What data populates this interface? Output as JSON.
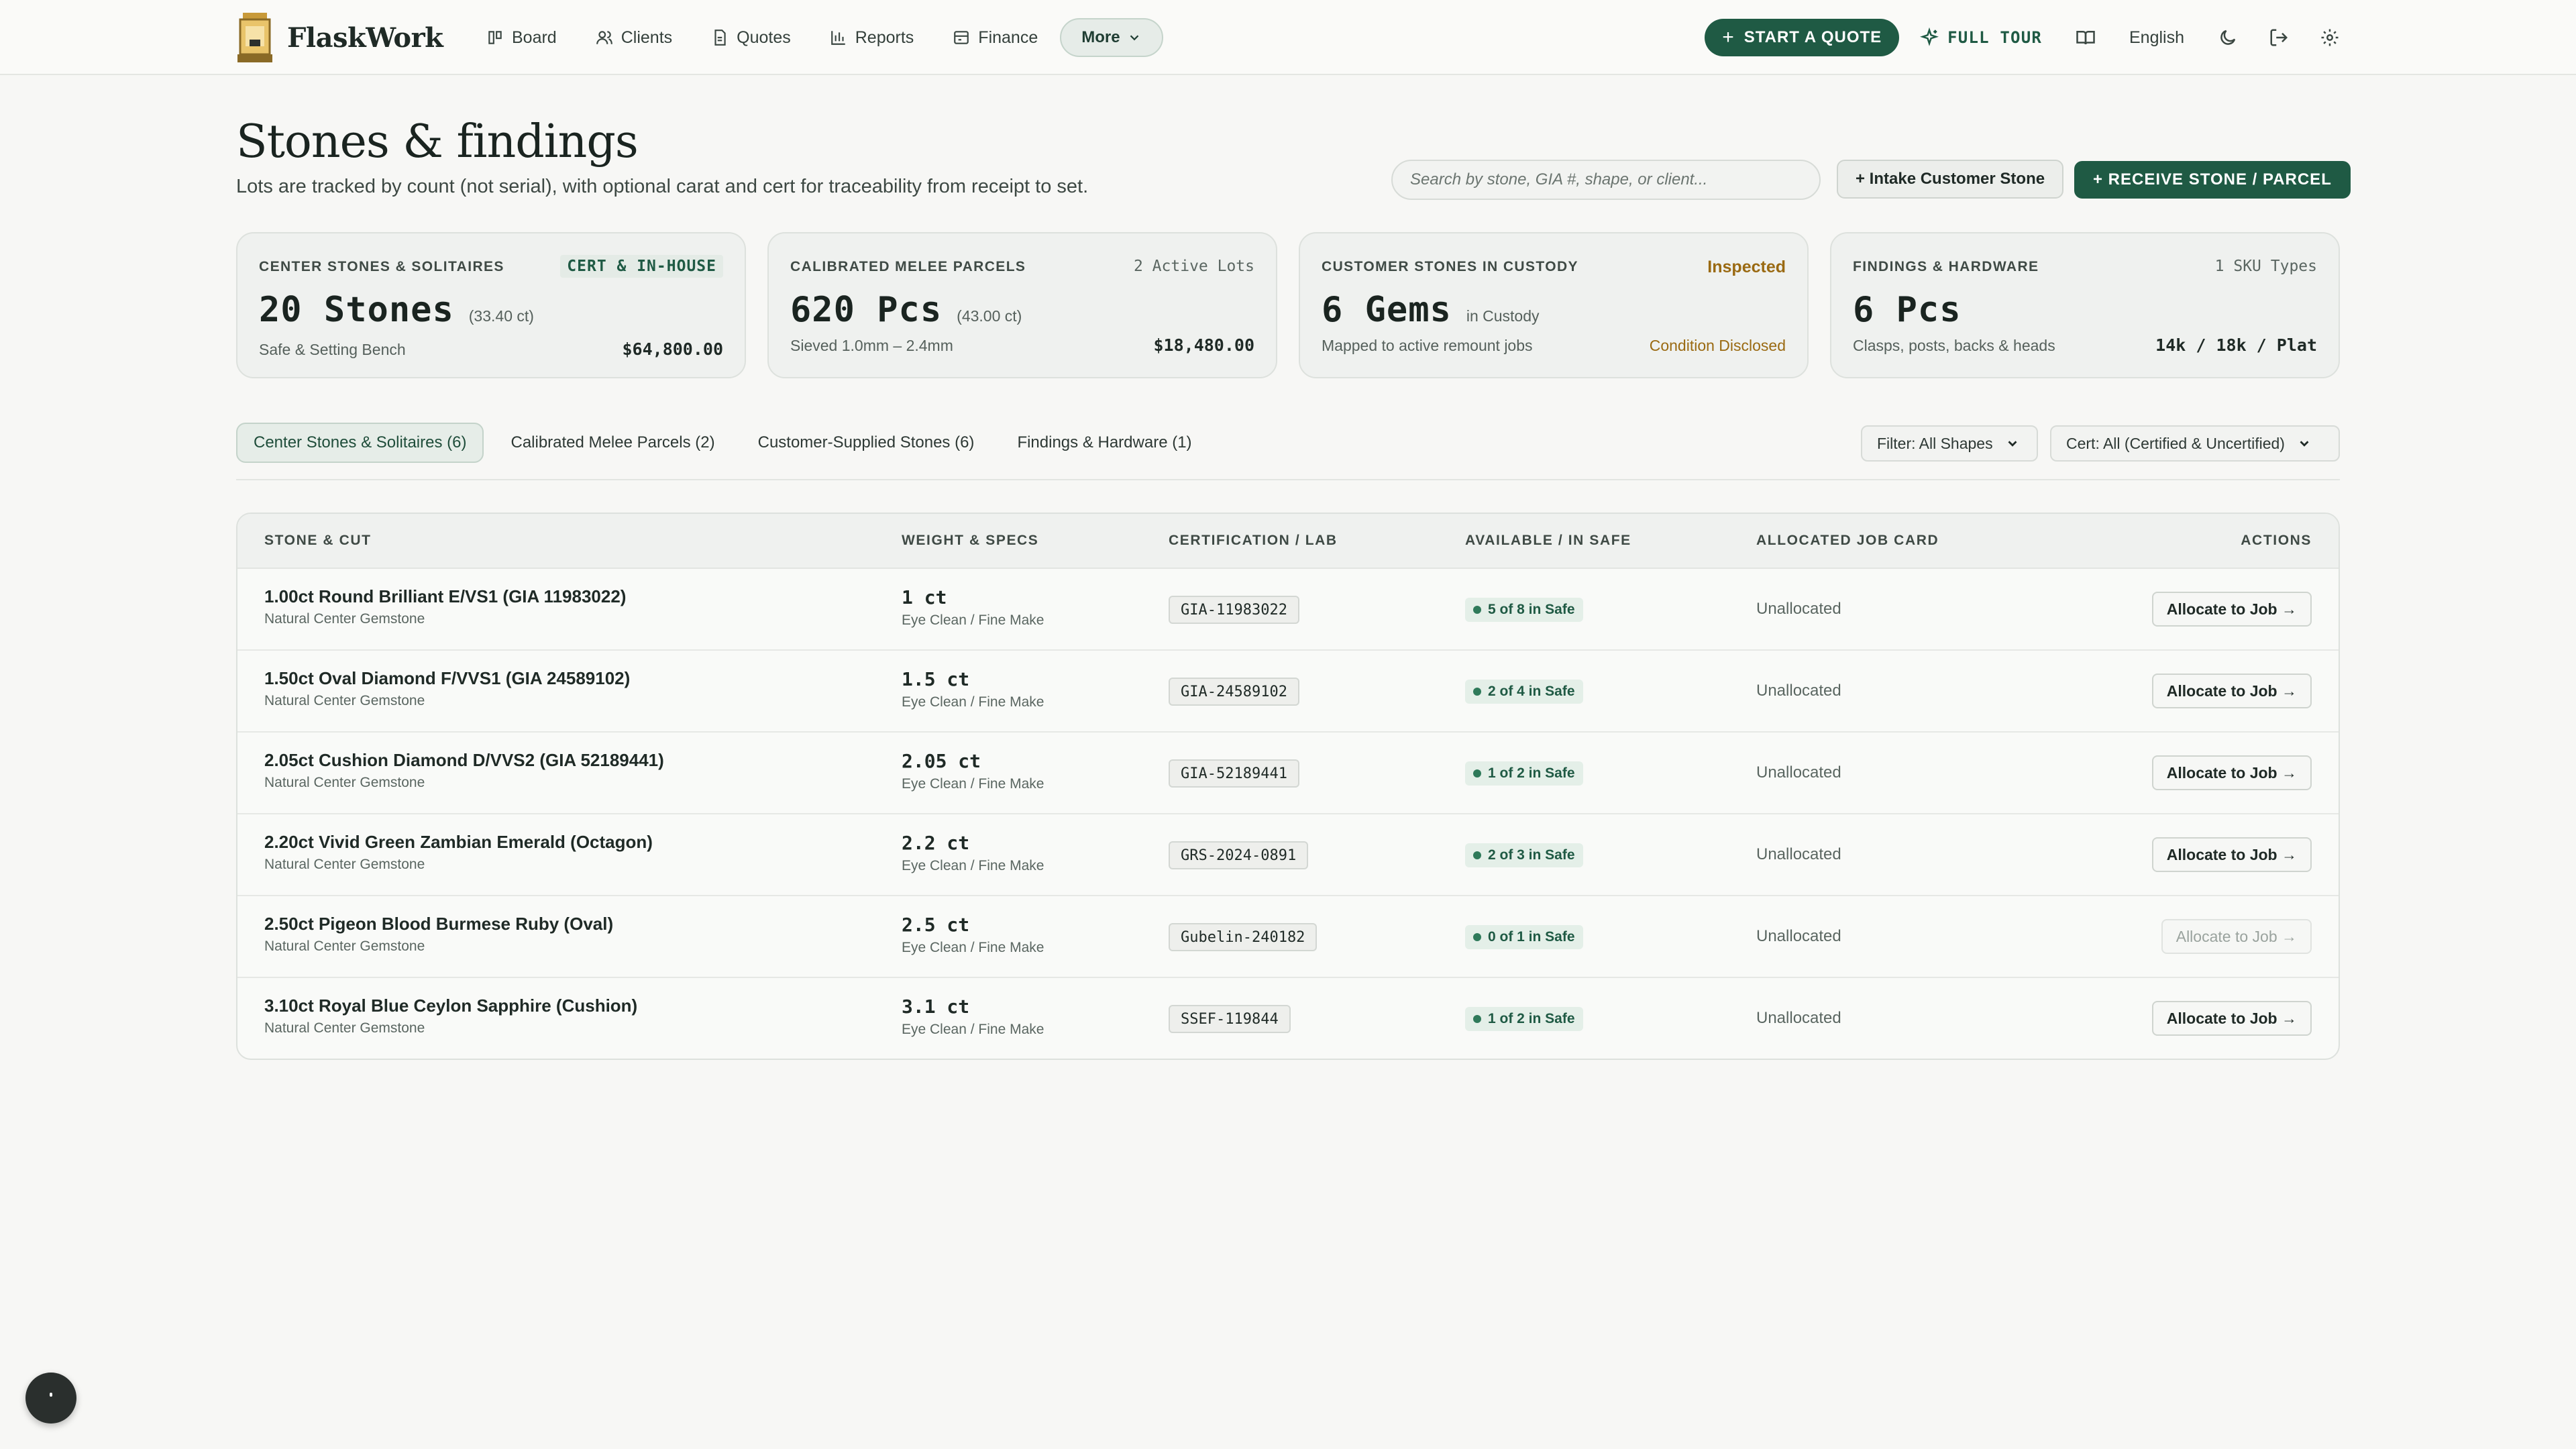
{
  "nav": {
    "brand": "FlaskWork",
    "links": [
      {
        "label": "Board",
        "icon": "board-icon"
      },
      {
        "label": "Clients",
        "icon": "users-icon"
      },
      {
        "label": "Quotes",
        "icon": "document-icon"
      },
      {
        "label": "Reports",
        "icon": "bar-chart-icon"
      },
      {
        "label": "Finance",
        "icon": "finance-icon"
      }
    ],
    "more_label": "More",
    "start_quote": "START A QUOTE",
    "full_tour": "FULL TOUR",
    "language": "English"
  },
  "header": {
    "title": "Stones & findings",
    "subtitle": "Lots are tracked by count (not serial), with optional carat and cert for traceability from receipt to set.",
    "search_placeholder": "Search by stone, GIA #, shape, or client...",
    "intake_button": "+ Intake Customer Stone",
    "receive_button": "+ RECEIVE STONE / PARCEL"
  },
  "cards": [
    {
      "label": "CENTER STONES & SOLITAIRES",
      "tag": "CERT & IN-HOUSE",
      "value": "20 Stones",
      "note": "(33.40 ct)",
      "desc": "Safe & Setting Bench",
      "right": "$64,800.00"
    },
    {
      "label": "CALIBRATED MELEE PARCELS",
      "tag": "2 Active Lots",
      "value": "620 Pcs",
      "note": "(43.00 ct)",
      "desc": "Sieved 1.0mm – 2.4mm",
      "right": "$18,480.00"
    },
    {
      "label": "CUSTOMER STONES IN CUSTODY",
      "tag": "Inspected",
      "value": "6 Gems",
      "note": "in Custody",
      "desc": "Mapped to active remount jobs",
      "right": "Condition Disclosed"
    },
    {
      "label": "FINDINGS & HARDWARE",
      "tag": "1 SKU Types",
      "value": "6 Pcs",
      "note": "",
      "desc": "Clasps, posts, backs & heads",
      "right": "14k / 18k / Plat"
    }
  ],
  "tabs": [
    "Center Stones & Solitaires (6)",
    "Calibrated Melee Parcels (2)",
    "Customer-Supplied Stones (6)",
    "Findings & Hardware (1)"
  ],
  "filters": {
    "shape": "Filter: All Shapes",
    "cert": "Cert: All (Certified & Uncertified)"
  },
  "table": {
    "headers": [
      "STONE & CUT",
      "WEIGHT & SPECS",
      "CERTIFICATION / LAB",
      "AVAILABLE / IN SAFE",
      "ALLOCATED JOB CARD",
      "ACTIONS"
    ],
    "rows": [
      {
        "name": "1.00ct Round Brilliant E/VS1 (GIA 11983022)",
        "sub": "Natural Center Gemstone",
        "weight": "1 ct",
        "specs": "Eye Clean / Fine Make",
        "cert": "GIA-11983022",
        "avail": "5 of 8 in Safe",
        "alloc": "Unallocated",
        "action": "Allocate to Job →",
        "disabled": false
      },
      {
        "name": "1.50ct Oval Diamond F/VVS1 (GIA 24589102)",
        "sub": "Natural Center Gemstone",
        "weight": "1.5 ct",
        "specs": "Eye Clean / Fine Make",
        "cert": "GIA-24589102",
        "avail": "2 of 4 in Safe",
        "alloc": "Unallocated",
        "action": "Allocate to Job →",
        "disabled": false
      },
      {
        "name": "2.05ct Cushion Diamond D/VVS2 (GIA 52189441)",
        "sub": "Natural Center Gemstone",
        "weight": "2.05 ct",
        "specs": "Eye Clean / Fine Make",
        "cert": "GIA-52189441",
        "avail": "1 of 2 in Safe",
        "alloc": "Unallocated",
        "action": "Allocate to Job →",
        "disabled": false
      },
      {
        "name": "2.20ct Vivid Green Zambian Emerald (Octagon)",
        "sub": "Natural Center Gemstone",
        "weight": "2.2 ct",
        "specs": "Eye Clean / Fine Make",
        "cert": "GRS-2024-0891",
        "avail": "2 of 3 in Safe",
        "alloc": "Unallocated",
        "action": "Allocate to Job →",
        "disabled": false
      },
      {
        "name": "2.50ct Pigeon Blood Burmese Ruby (Oval)",
        "sub": "Natural Center Gemstone",
        "weight": "2.5 ct",
        "specs": "Eye Clean / Fine Make",
        "cert": "Gubelin-240182",
        "avail": "0 of 1 in Safe",
        "alloc": "Unallocated",
        "action": "Allocate to Job →",
        "disabled": true
      },
      {
        "name": "3.10ct Royal Blue Ceylon Sapphire (Cushion)",
        "sub": "Natural Center Gemstone",
        "weight": "3.1 ct",
        "specs": "Eye Clean / Fine Make",
        "cert": "SSEF-119844",
        "avail": "1 of 2 in Safe",
        "alloc": "Unallocated",
        "action": "Allocate to Job →",
        "disabled": false
      }
    ]
  },
  "colors": {
    "accent": "#1f5a44",
    "warn": "#9a6a12",
    "background": "#f7f7f5"
  }
}
